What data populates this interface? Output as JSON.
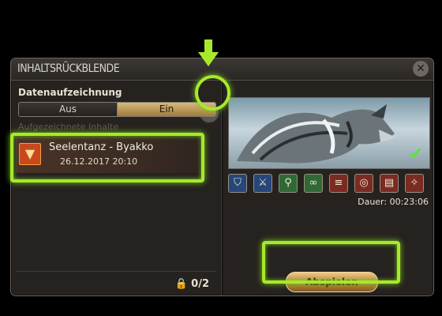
{
  "window": {
    "title": "INHALTSRÜCKBLENDE",
    "close_icon": "close-icon"
  },
  "recording": {
    "label": "Datenaufzeichnung",
    "help_label": "?",
    "toggle_off": "Aus",
    "toggle_on": "Ein",
    "selected": "Ein"
  },
  "content": {
    "section_label": "Aufgezeichnete Inhalte",
    "entries": [
      {
        "name": "Seelentanz - Byakko",
        "date": "26.12.2017 20:10"
      }
    ],
    "count": "0/2"
  },
  "preview": {
    "duration": "Dauer: 00:23:06",
    "job_icons": [
      "shield-icon",
      "sword-icon",
      "staff-icon",
      "bow-icon",
      "claws-icon",
      "ring-icon",
      "book-icon",
      "gear-icon"
    ],
    "checked": true
  },
  "actions": {
    "play_label": "Abspielen"
  },
  "colors": {
    "highlight": "#a8e82c",
    "accent": "#d8b87c"
  }
}
